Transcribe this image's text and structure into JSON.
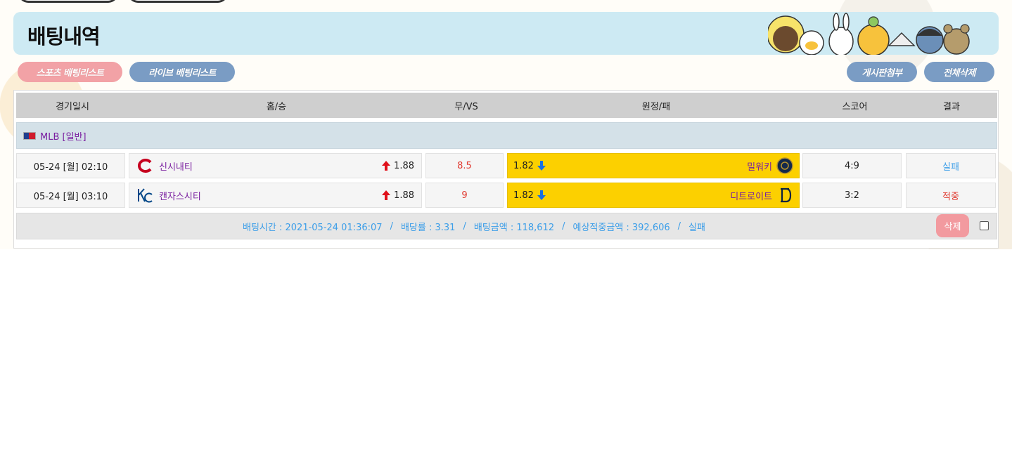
{
  "page": {
    "title": "배팅내역"
  },
  "tabs": {
    "sports": "스포츠 배팅리스트",
    "live": "라이브 배팅리스트",
    "attach": "게시판첨부",
    "delete_all": "전체삭제"
  },
  "columns": [
    "경기일시",
    "홈/승",
    "무/VS",
    "원정/패",
    "스코어",
    "결과"
  ],
  "league": "MLB [일반]",
  "rows": [
    {
      "date": "05-24 [월] 02:10",
      "home": "신시내티",
      "home_odds": "1.88",
      "draw": "8.5",
      "away_odds": "1.82",
      "away": "밀워키",
      "score": "4:9",
      "result": "실패"
    },
    {
      "date": "05-24 [월] 03:10",
      "home": "캔자스시티",
      "home_odds": "1.88",
      "draw": "9",
      "away_odds": "1.82",
      "away": "디트로이트",
      "score": "3:2",
      "result": "적중"
    }
  ],
  "summary": {
    "time": "배팅시간 : 2021-05-24 01:36:07",
    "rate": "배당률 : 3.31",
    "amount": "배팅금액 : 118,612",
    "expected": "예상적중금액 : 392,606",
    "status": "실패",
    "delete": "삭제"
  },
  "colors": {
    "header_bg": "#cdeaf3",
    "away_highlight": "#fcd000",
    "fail": "#3c9ee8",
    "win": "#e0392f",
    "team_text": "#7a1fa0"
  },
  "icons": [
    "mlb-flag-icon",
    "reds-logo-icon",
    "royals-logo-icon",
    "brewers-logo-icon",
    "tigers-logo-icon",
    "arrow-up-icon",
    "arrow-down-icon"
  ]
}
